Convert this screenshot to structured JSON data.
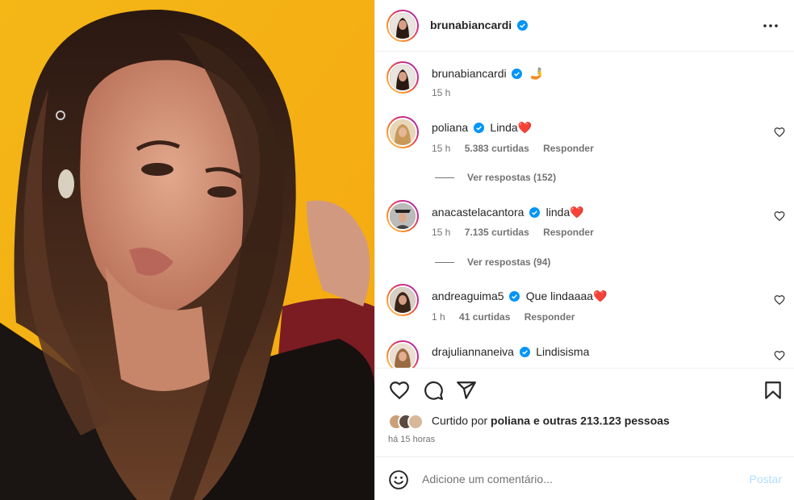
{
  "post_author": {
    "username": "brunabiancardi",
    "verified": true
  },
  "caption": {
    "username": "brunabiancardi",
    "emoji": "🤳",
    "time": "15 h"
  },
  "comments": [
    {
      "username": "poliana",
      "text": "Linda",
      "heart": "❤️",
      "time": "15 h",
      "likes": "5.383 curtidas",
      "reply": "Responder",
      "replies": "Ver respostas (152)"
    },
    {
      "username": "anacastelacantora",
      "text": "linda",
      "heart": "❤️",
      "time": "15 h",
      "likes": "7.135 curtidas",
      "reply": "Responder",
      "replies": "Ver respostas (94)"
    },
    {
      "username": "andreaguima5",
      "text": "Que lindaaaa",
      "heart": "❤️",
      "time": "1 h",
      "likes": "41 curtidas",
      "reply": "Responder"
    },
    {
      "username": "drajuliannaneiva",
      "text": "Lindisisma"
    }
  ],
  "liked_by": {
    "prefix": "Curtido por",
    "user": "poliana",
    "suffix": "e outras 213.123 pessoas"
  },
  "time_ago": "há 15 horas",
  "add_comment": {
    "placeholder": "Adicione um comentário...",
    "post_label": "Postar"
  },
  "colors": {
    "verified": "#0095f6",
    "heart": "#e0202e",
    "photo_bg": "#f2b519",
    "post_disabled": "#b2dffc"
  }
}
